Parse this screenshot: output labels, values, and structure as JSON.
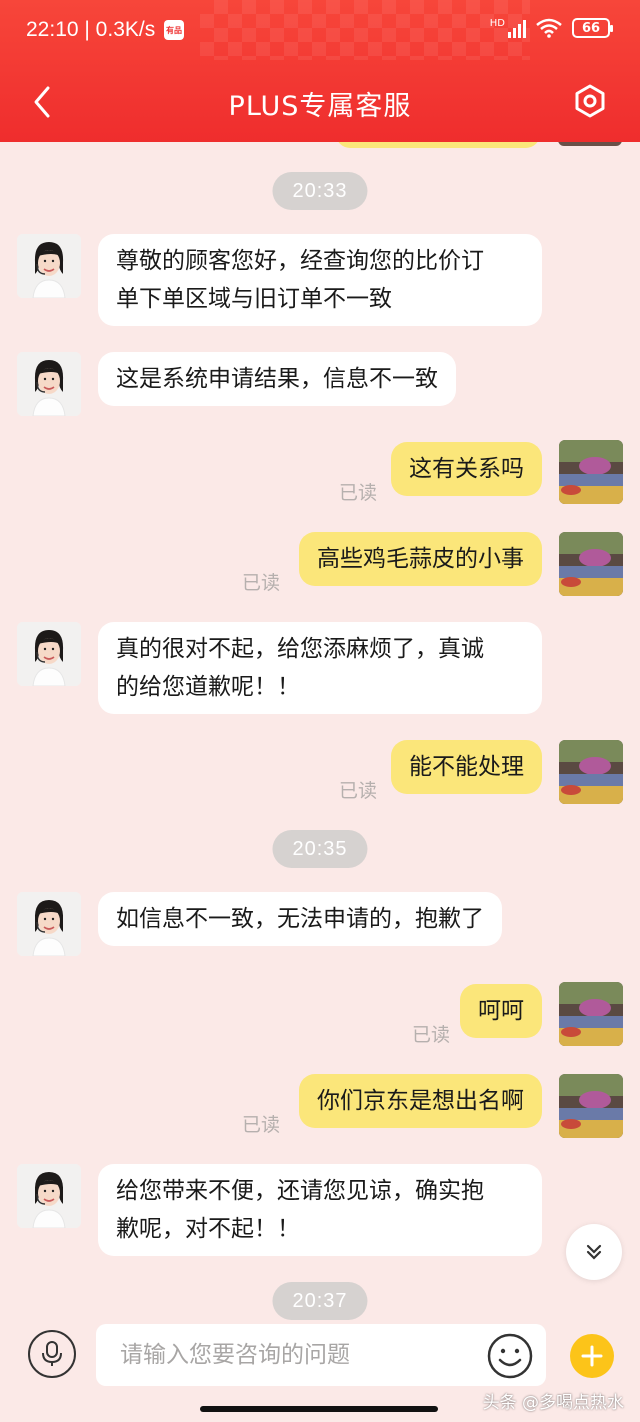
{
  "status_bar": {
    "time_speed": "22:10 | 0.3K/s",
    "app_badge": "有品",
    "network_label": "HD",
    "battery": "66"
  },
  "nav": {
    "title": "PLUS专属客服"
  },
  "chat": {
    "timestamps": [
      "20:33",
      "20:35",
      "20:37"
    ],
    "read_label": "已读",
    "messages": [
      {
        "sender": "agent",
        "text_lines": [
          "尊敬的顾客您好，经查询您的比价订",
          "单下单区域与旧订单不一致"
        ]
      },
      {
        "sender": "agent",
        "text_lines": [
          "这是系统申请结果，信息不一致"
        ]
      },
      {
        "sender": "user",
        "text_lines": [
          "这有关系吗"
        ],
        "read": "已读"
      },
      {
        "sender": "user",
        "text_lines": [
          "高些鸡毛蒜皮的小事"
        ],
        "read": "已读"
      },
      {
        "sender": "agent",
        "text_lines": [
          "真的很对不起，给您添麻烦了，真诚",
          "的给您道歉呢！！"
        ]
      },
      {
        "sender": "user",
        "text_lines": [
          "能不能处理"
        ],
        "read": "已读"
      },
      {
        "sender": "agent",
        "text_lines": [
          "如信息不一致，无法申请的，抱歉了"
        ]
      },
      {
        "sender": "user",
        "text_lines": [
          "呵呵"
        ],
        "read": "已读"
      },
      {
        "sender": "user",
        "text_lines": [
          "你们京东是想出名啊"
        ],
        "read": "已读"
      },
      {
        "sender": "agent",
        "text_lines": [
          "给您带来不便，还请您见谅，确实抱",
          "歉呢，对不起！！"
        ]
      }
    ]
  },
  "input": {
    "placeholder": "请输入您要咨询的问题"
  },
  "watermark": "头条 @多喝点热水",
  "colors": {
    "header": "#ef2d2d",
    "background": "#fbe9e7",
    "user_bubble": "#fbe67a",
    "agent_bubble": "#ffffff",
    "plus_button": "#fcc419"
  },
  "icons": {
    "back": "chevron-left-icon",
    "settings": "hex-gear-icon",
    "mic": "microphone-icon",
    "emoji": "smiley-icon",
    "plus": "plus-icon",
    "scroll_down": "double-chevron-down-icon"
  }
}
